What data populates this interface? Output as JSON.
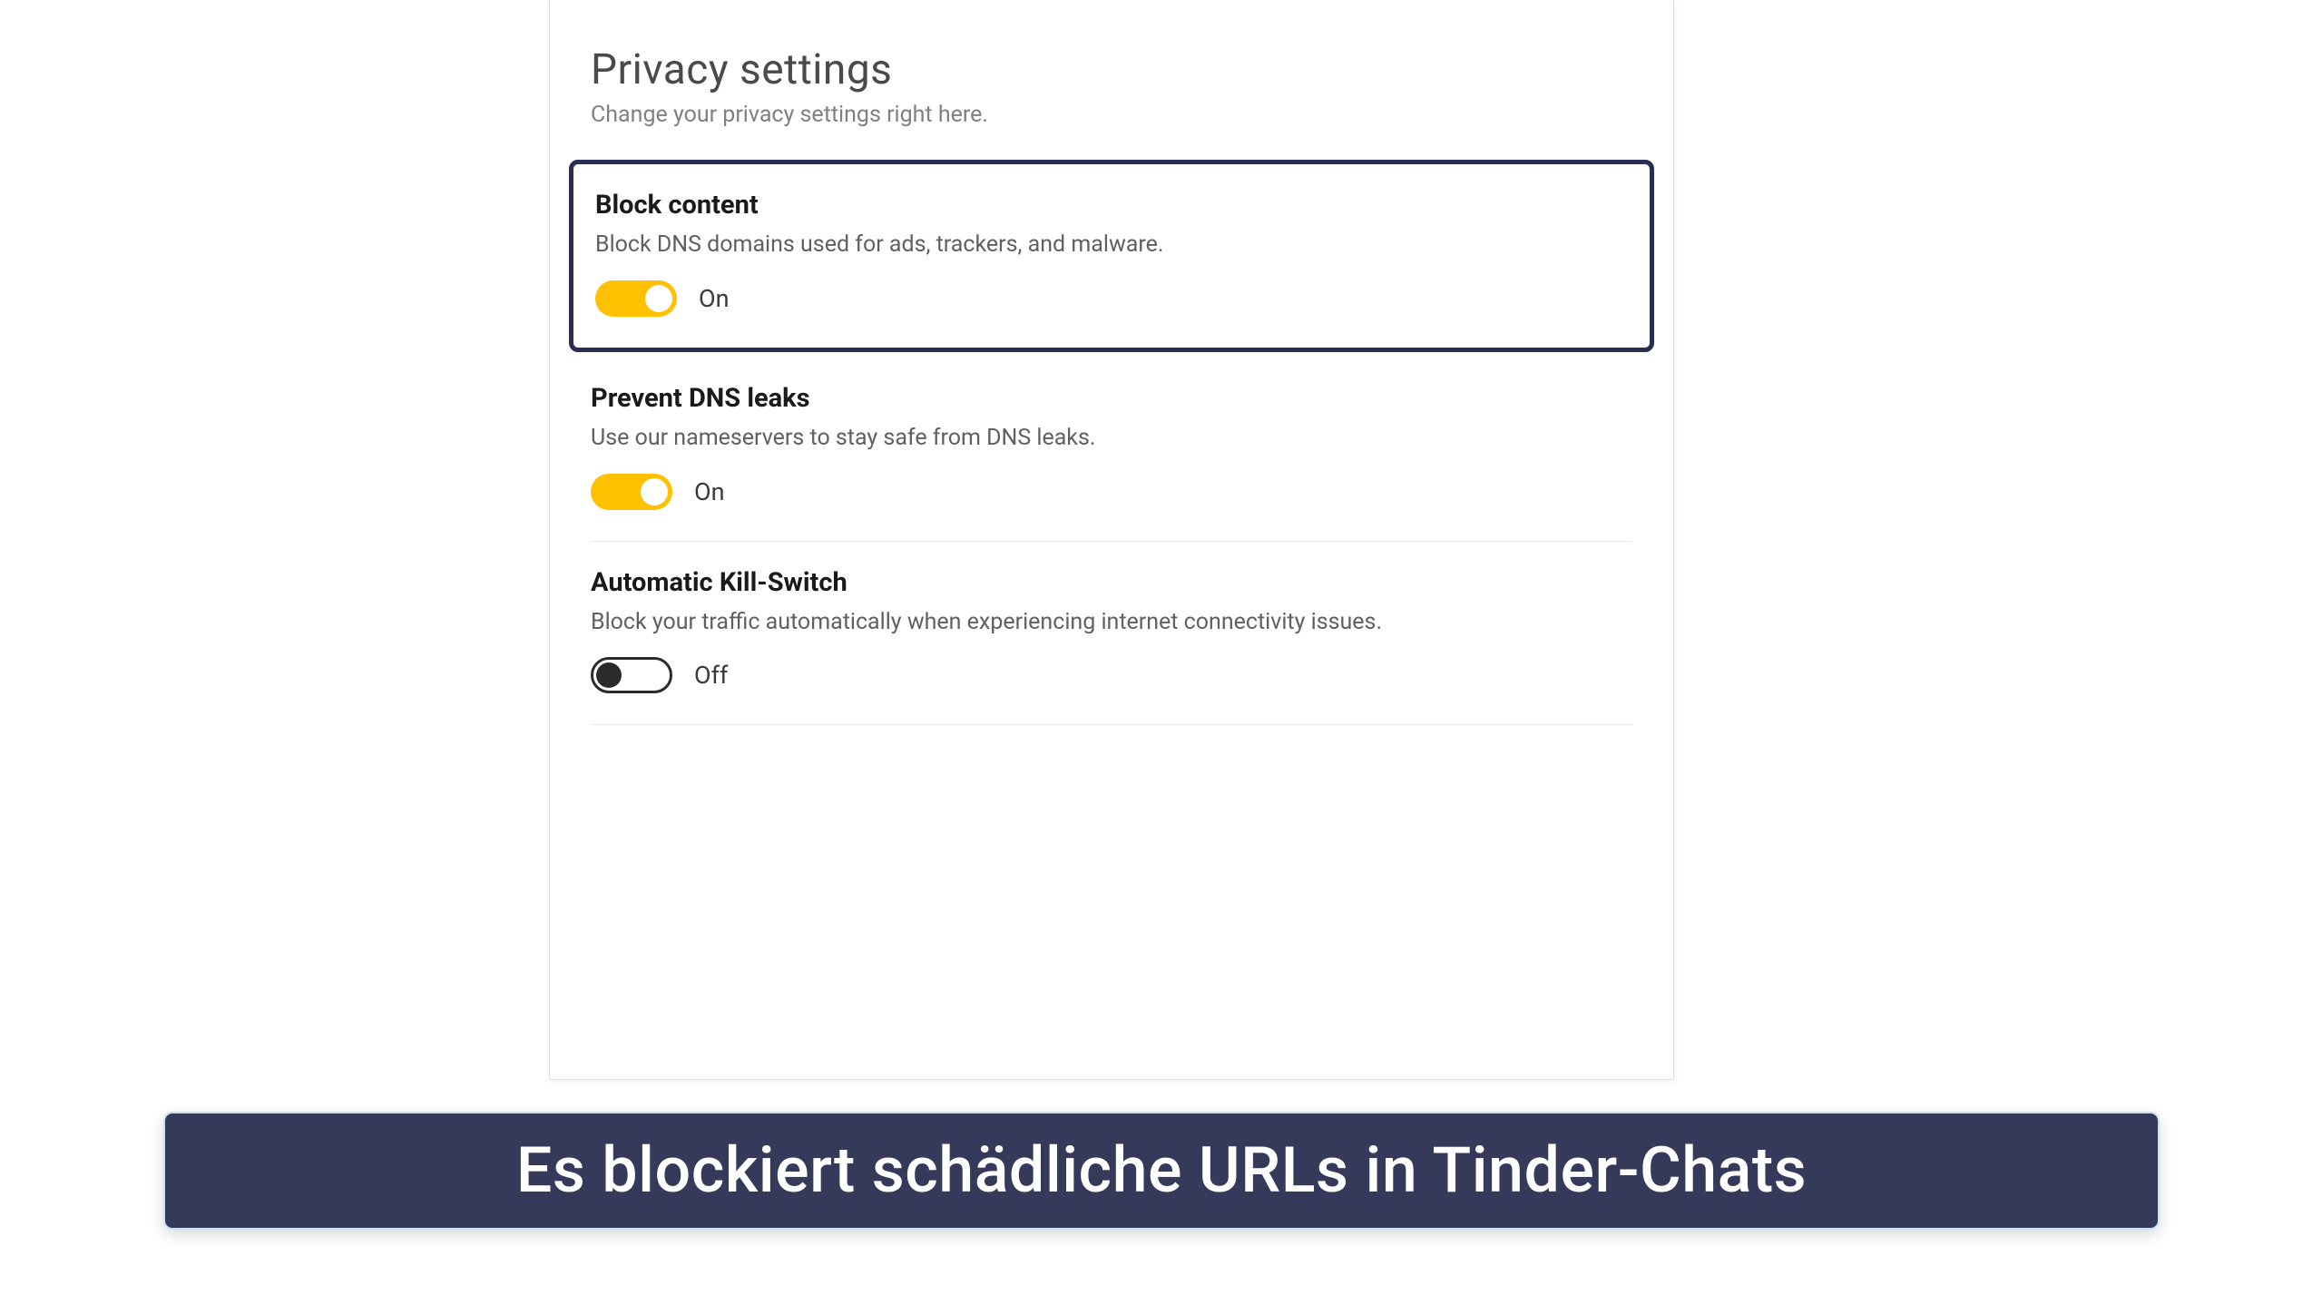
{
  "page": {
    "title": "Privacy settings",
    "subtitle": "Change your privacy settings right here."
  },
  "settings": {
    "block_content": {
      "title": "Block content",
      "desc": "Block DNS domains used for ads, trackers, and malware.",
      "state": "On",
      "on": true
    },
    "prevent_dns": {
      "title": "Prevent DNS leaks",
      "desc": "Use our nameservers to stay safe from DNS leaks.",
      "state": "On",
      "on": true
    },
    "kill_switch": {
      "title": "Automatic Kill-Switch",
      "desc": "Block your traffic automatically when experiencing internet connectivity issues.",
      "state": "Off",
      "on": false
    }
  },
  "caption": "Es blockiert schädliche URLs in Tinder-Chats",
  "colors": {
    "toggle_on": "#ffc000",
    "highlight_border": "#2a2e55",
    "caption_bg": "#363a5a",
    "tab_accent": "#2b6fd1"
  }
}
